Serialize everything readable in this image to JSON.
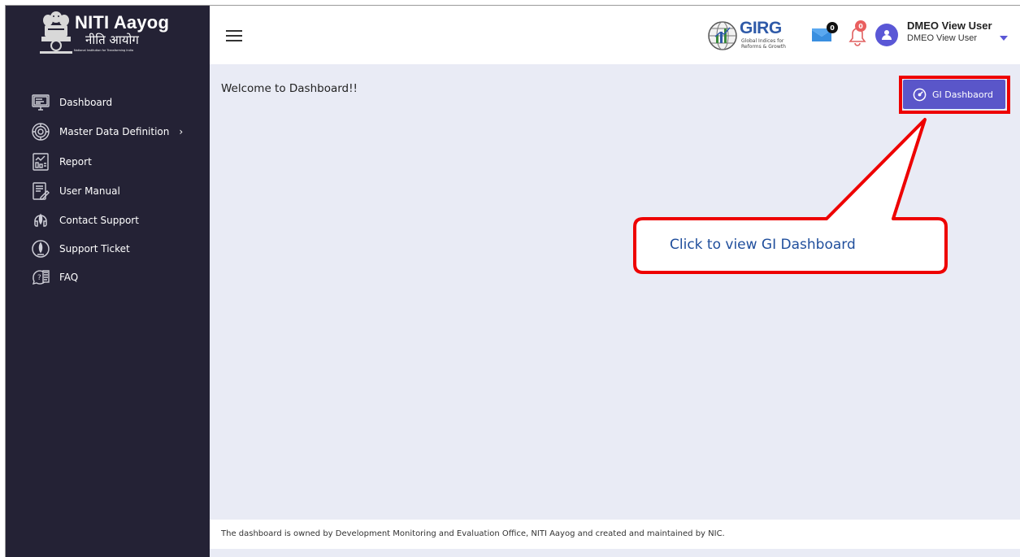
{
  "brand": {
    "title": "NITI Aayog",
    "hindi": "नीति आयोग",
    "tagline": "National Institution for Transforming India",
    "emblem_motto": "सत्यमेव जयते"
  },
  "sidebar": {
    "items": [
      {
        "label": "Dashboard",
        "icon": "monitor-icon"
      },
      {
        "label": "Master Data Definition",
        "icon": "settings-icon",
        "chevron": "›"
      },
      {
        "label": "Report",
        "icon": "report-icon"
      },
      {
        "label": "User Manual",
        "icon": "manual-icon"
      },
      {
        "label": "Contact Support",
        "icon": "support-icon"
      },
      {
        "label": "Support Ticket",
        "icon": "ticket-icon"
      },
      {
        "label": "FAQ",
        "icon": "faq-icon"
      }
    ]
  },
  "header": {
    "girg": {
      "title": "GIRG",
      "subtitle_line1": "Global Indices for",
      "subtitle_line2": "Reforms & Growth"
    },
    "messages_count": "0",
    "notifications_count": "0",
    "user": {
      "name": "DMEO View User",
      "role": "DMEO View User"
    }
  },
  "main": {
    "welcome": "Welcome to Dashboard!!",
    "gi_button_label": "GI Dashbaord",
    "callout_text": "Click to view  GI  Dashboard"
  },
  "footer": {
    "text": "The dashboard is owned by Development Monitoring and Evaluation Office, NITI Aayog and created and maintained by NIC."
  },
  "colors": {
    "sidebar_bg": "#242235",
    "accent": "#5a56c9",
    "annotation_red": "#ee0000",
    "callout_text": "#1f4e9c",
    "main_bg": "#e9ebf5"
  }
}
